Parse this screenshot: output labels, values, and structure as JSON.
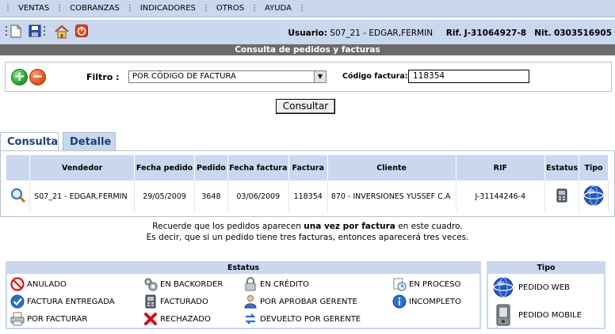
{
  "menu": {
    "items": [
      "VENTAS",
      "COBRANZAS",
      "INDICADORES",
      "OTROS",
      "AYUDA"
    ],
    "separator": "⋮"
  },
  "toolbar": {
    "user_label": "Usuario:",
    "user_value": "S07_21 - EDGAR,FERMIN",
    "rif_label": "Rif.",
    "rif_value": "J-31064927-8",
    "nit_label": "Nit.",
    "nit_value": "0303516905"
  },
  "page": {
    "title": "Consulta de pedidos y facturas"
  },
  "filter": {
    "label": "Filtro :",
    "selected": "POR CÓDIGO DE FACTURA",
    "code_label": "Código factura:",
    "code_value": "118354",
    "button": "Consultar"
  },
  "tabs": [
    "Consulta",
    "Detalle"
  ],
  "table": {
    "headers": [
      "",
      "Vendedor",
      "Fecha pedido",
      "Pedido",
      "Fecha factura",
      "Factura",
      "Cliente",
      "RIF",
      "Estatus",
      "Tipo"
    ],
    "rows": [
      {
        "vendedor": "S07_21 - EDGAR,FERMIN",
        "fecha_pedido": "29/05/2009",
        "pedido": "3648",
        "fecha_factura": "03/06/2009",
        "factura": "118354",
        "cliente": "870 - INVERSIONES YUSSEF C.A",
        "rif": "J-31144246-4",
        "estatus_icon": "facturado-icon",
        "tipo_icon": "pedido-web-icon"
      }
    ]
  },
  "note": {
    "line1_pre": "Recuerde que los pedidos aparecen ",
    "line1_bold": "una vez por factura",
    "line1_post": " en este cuadro.",
    "line2": "Es decir, que si un pedido tiene tres facturas, entonces aparecerá tres veces."
  },
  "status_legend": {
    "title": "Estatus",
    "items": [
      {
        "label": "ANULADO",
        "icon": "anulado-icon"
      },
      {
        "label": "EN BACKORDER",
        "icon": "gears-icon"
      },
      {
        "label": "EN CRÉDITO",
        "icon": "lock-icon"
      },
      {
        "label": "EN PROCESO",
        "icon": "process-icon"
      },
      {
        "label": "FACTURA ENTREGADA",
        "icon": "checkmark-icon"
      },
      {
        "label": "FACTURADO",
        "icon": "facturado-icon"
      },
      {
        "label": "POR APROBAR GERENTE",
        "icon": "manager-icon"
      },
      {
        "label": "INCOMPLETO",
        "icon": "info-icon"
      },
      {
        "label": "POR FACTURAR",
        "icon": "printer-icon"
      },
      {
        "label": "RECHAZADO",
        "icon": "rejected-icon"
      },
      {
        "label": "DEVUELTO POR GERENTE",
        "icon": "returned-icon"
      }
    ]
  },
  "tipo_legend": {
    "title": "Tipo",
    "items": [
      {
        "label": "PEDIDO WEB",
        "icon": "globe-icon"
      },
      {
        "label": "PEDIDO MOBILE",
        "icon": "pda-icon"
      }
    ]
  },
  "colors": {
    "panel": "#c9d7ef",
    "title_bar": "#6b6b6b",
    "tab_text": "#1c3f7a"
  }
}
